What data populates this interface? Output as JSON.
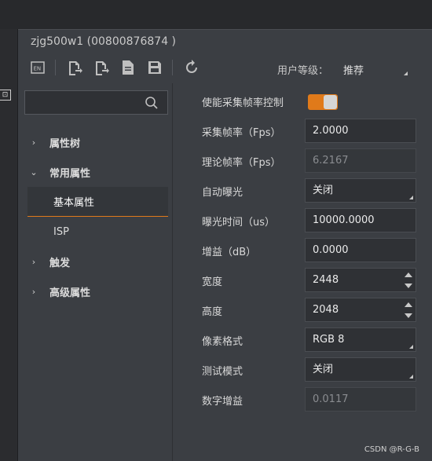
{
  "window": {
    "title": "zjg500w1  (00800876874 )"
  },
  "toolbar": {
    "icons": [
      "language-en-icon",
      "import-icon",
      "export-icon",
      "file-icon",
      "save-icon",
      "refresh-icon"
    ],
    "user_level_label": "用户等级：",
    "user_level_value": "推荐"
  },
  "search": {
    "placeholder": "",
    "value": ""
  },
  "tree": [
    {
      "label": "属性树",
      "expanded": false
    },
    {
      "label": "常用属性",
      "expanded": true
    },
    {
      "label": "基本属性",
      "selected": true
    },
    {
      "label": "ISP"
    },
    {
      "label": "触发",
      "expanded": false
    },
    {
      "label": "高级属性",
      "expanded": false
    }
  ],
  "properties": [
    {
      "label": "使能采集帧率控制",
      "type": "toggle",
      "value": "on"
    },
    {
      "label": "采集帧率（Fps）",
      "type": "input",
      "value": "2.0000"
    },
    {
      "label": "理论帧率（Fps）",
      "type": "readonly",
      "value": "6.2167"
    },
    {
      "label": "自动曝光",
      "type": "select",
      "value": "关闭"
    },
    {
      "label": "曝光时间（us）",
      "type": "input",
      "value": "10000.0000"
    },
    {
      "label": "增益（dB）",
      "type": "input",
      "value": "0.0000"
    },
    {
      "label": "宽度",
      "type": "spin",
      "value": "2448"
    },
    {
      "label": "高度",
      "type": "spin",
      "value": "2048"
    },
    {
      "label": "像素格式",
      "type": "select",
      "value": "RGB 8"
    },
    {
      "label": "测试模式",
      "type": "select",
      "value": "关闭"
    },
    {
      "label": "数字增益",
      "type": "readonly",
      "value": "0.0117"
    }
  ],
  "watermark": "CSDN @R-G-B",
  "colors": {
    "accent": "#e07a1a",
    "background": "#3b3e43",
    "field": "#2f3135"
  }
}
